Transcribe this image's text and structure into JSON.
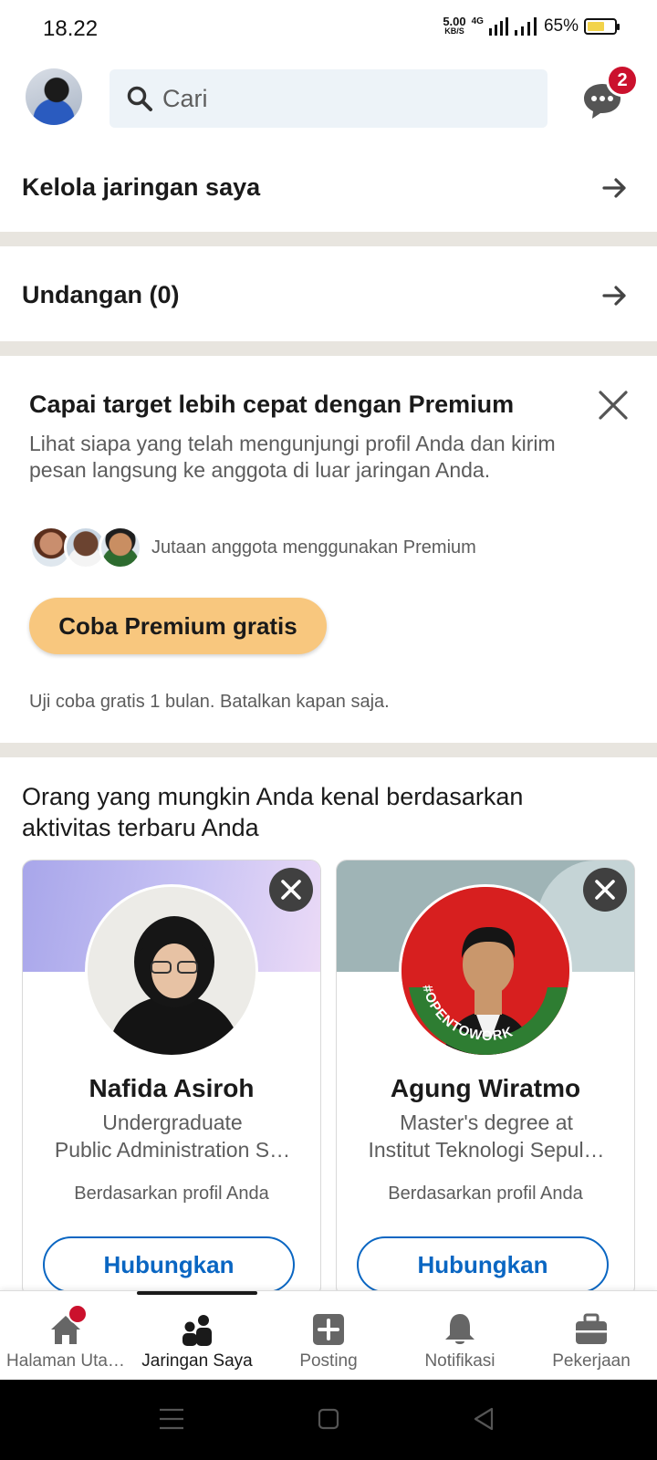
{
  "status_bar": {
    "time": "18.22",
    "net_speed_value": "5.00",
    "net_speed_unit": "KB/S",
    "network_label": "4G",
    "battery_percent": "65%",
    "battery_level": 0.65
  },
  "top_bar": {
    "search_placeholder": "Cari",
    "messages_badge": "2"
  },
  "rows": {
    "manage_network": "Kelola jaringan saya",
    "invitations": "Undangan (0)"
  },
  "premium": {
    "title": "Capai target lebih cepat dengan Premium",
    "description": "Lihat siapa yang telah mengunjungi profil Anda dan kirim pesan langsung ke anggota di luar jaringan Anda.",
    "members_text": "Jutaan anggota menggunakan Premium",
    "cta_label": "Coba Premium gratis",
    "note": "Uji coba gratis 1 bulan. Batalkan kapan saja."
  },
  "pymk": {
    "heading": "Orang yang mungkin Anda kenal berdasarkan aktivitas terbaru Anda",
    "people": [
      {
        "name": "Nafida Asiroh",
        "headline_line1": "Undergraduate",
        "headline_line2": "Public Administration S…",
        "reason": "Berdasarkan profil Anda",
        "connect_label": "Hubungkan"
      },
      {
        "name": "Agung Wiratmo",
        "headline_line1": "Master's degree at",
        "headline_line2": "Institut Teknologi Sepul…",
        "reason": "Berdasarkan profil Anda",
        "connect_label": "Hubungkan",
        "photo_frame_text": "#OPENTOWORK"
      }
    ]
  },
  "bottom_nav": {
    "items": [
      {
        "label": "Halaman Uta…",
        "icon": "home-icon"
      },
      {
        "label": "Jaringan Saya",
        "icon": "people-icon"
      },
      {
        "label": "Posting",
        "icon": "plus-square-icon"
      },
      {
        "label": "Notifikasi",
        "icon": "bell-icon"
      },
      {
        "label": "Pekerjaan",
        "icon": "briefcase-icon"
      }
    ],
    "active_index": 1
  },
  "colors": {
    "brand_blue": "#0a66c2",
    "badge_red": "#cb112d",
    "premium_gold": "#f8c77e",
    "divider": "#e8e5df"
  }
}
